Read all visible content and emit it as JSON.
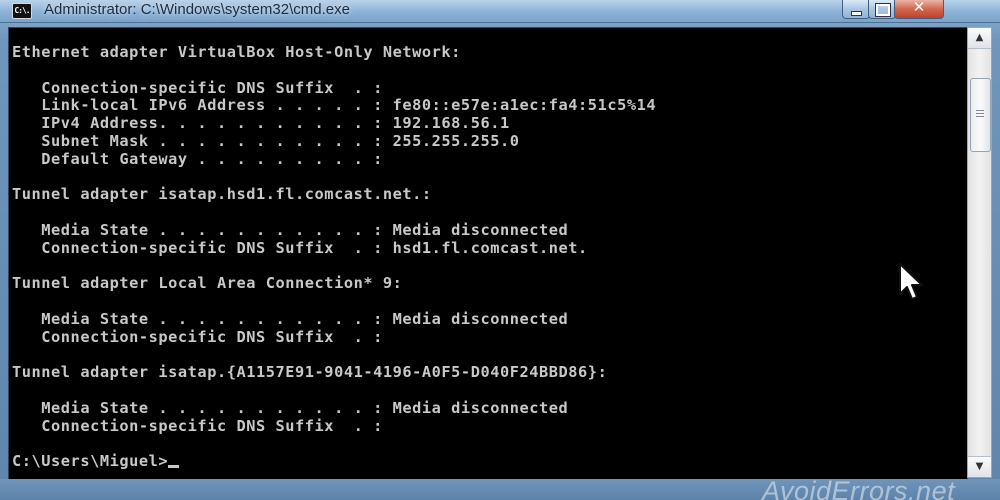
{
  "window": {
    "icon_text": "C:\\.",
    "title": "Administrator: C:\\Windows\\system32\\cmd.exe",
    "close_glyph": "✕"
  },
  "console": {
    "lines": [
      "Ethernet adapter VirtualBox Host-Only Network:",
      "",
      "   Connection-specific DNS Suffix  . :",
      "   Link-local IPv6 Address . . . . . : fe80::e57e:a1ec:fa4:51c5%14",
      "   IPv4 Address. . . . . . . . . . . : 192.168.56.1",
      "   Subnet Mask . . . . . . . . . . . : 255.255.255.0",
      "   Default Gateway . . . . . . . . . :",
      "",
      "Tunnel adapter isatap.hsd1.fl.comcast.net.:",
      "",
      "   Media State . . . . . . . . . . . : Media disconnected",
      "   Connection-specific DNS Suffix  . : hsd1.fl.comcast.net.",
      "",
      "Tunnel adapter Local Area Connection* 9:",
      "",
      "   Media State . . . . . . . . . . . : Media disconnected",
      "   Connection-specific DNS Suffix  . :",
      "",
      "Tunnel adapter isatap.{A1157E91-9041-4196-A0F5-D040F24BBD86}:",
      "",
      "   Media State . . . . . . . . . . . : Media disconnected",
      "   Connection-specific DNS Suffix  . :",
      ""
    ],
    "prompt": "C:\\Users\\Miguel>"
  },
  "watermark": "AvoidErrors.net",
  "colors": {
    "console_text": "#c8c8c8",
    "console_bg": "#000000",
    "frame": "#6f97bd"
  }
}
